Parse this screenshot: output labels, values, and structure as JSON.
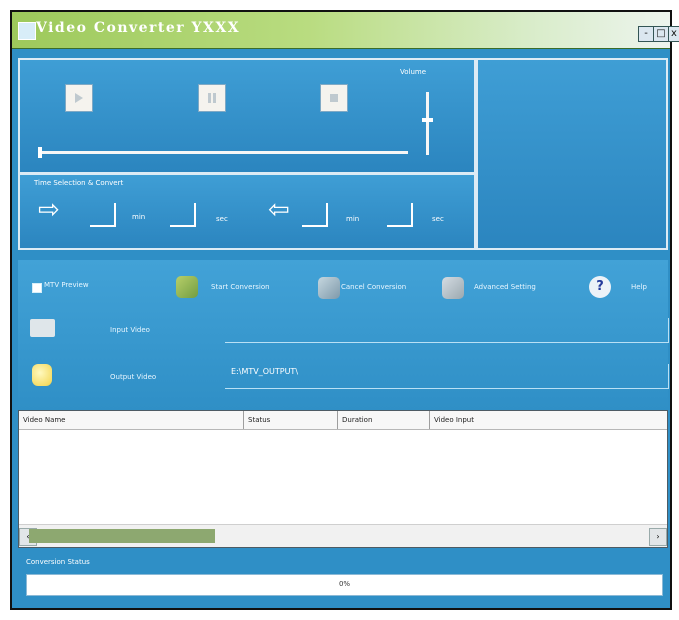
{
  "window": {
    "title": "Video Converter YXXX",
    "minimize_label": "-",
    "restore_label": "□",
    "close_label": "x"
  },
  "player": {
    "volume_label": "Volume"
  },
  "time_selection": {
    "title": "Time Selection & Convert",
    "unit_1": "min",
    "unit_2": "sec",
    "unit_3": "min",
    "unit_4": "sec"
  },
  "toolbar": {
    "preview_checkbox_label": "MTV Preview",
    "start_label": "Start Conversion",
    "cancel_label": "Cancel Conversion",
    "settings_label": "Advanced Setting",
    "help_label": "Help"
  },
  "input_video": {
    "label": "Input Video",
    "value": ""
  },
  "output_video": {
    "label": "Output Video",
    "value": "E:\\MTV_OUTPUT\\"
  },
  "table": {
    "columns": [
      "Video Name",
      "Status",
      "Duration",
      "Video Input"
    ],
    "rows": []
  },
  "conversion": {
    "label": "Conversion Status",
    "percent_text": "0%",
    "progress": 0
  },
  "colors": {
    "accent": "#2f8fc6",
    "title_gradient_start": "#9dc95b",
    "title_gradient_end": "#edf4ee"
  },
  "icons": {
    "play": "play-icon",
    "pause": "pause-icon",
    "stop": "stop-icon",
    "start_in": "right-arrow-icon",
    "start_out": "left-arrow-icon",
    "input": "film-icon",
    "output": "folder-icon",
    "help": "help-icon"
  }
}
